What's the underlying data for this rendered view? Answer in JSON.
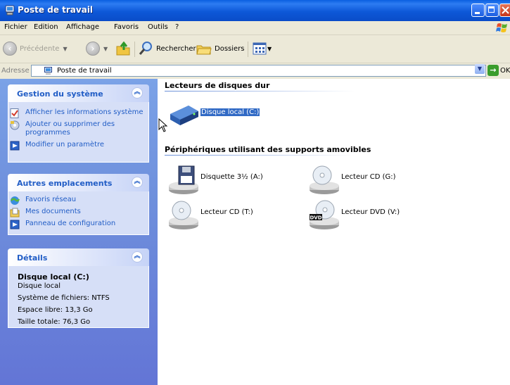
{
  "window": {
    "title": "Poste de travail"
  },
  "menu": [
    "Fichier",
    "Edition",
    "Affichage",
    "Favoris",
    "Outils",
    "?"
  ],
  "toolbar": {
    "back_label": "Précédente",
    "search_label": "Rechercher",
    "folders_label": "Dossiers"
  },
  "address": {
    "label": "Adresse",
    "value": "Poste de travail",
    "go_label": "OK"
  },
  "panels": {
    "system": {
      "title": "Gestion du système",
      "items": [
        {
          "label": "Afficher les informations système",
          "icon": "system-info-icon"
        },
        {
          "label": "Ajouter ou supprimer des programmes",
          "icon": "add-remove-programs-icon"
        },
        {
          "label": "Modifier un paramètre",
          "icon": "control-panel-icon"
        }
      ]
    },
    "places": {
      "title": "Autres emplacements",
      "items": [
        {
          "label": "Favoris réseau",
          "icon": "network-places-icon"
        },
        {
          "label": "Mes documents",
          "icon": "my-documents-icon"
        },
        {
          "label": "Panneau de configuration",
          "icon": "control-panel-icon"
        }
      ]
    },
    "details": {
      "title": "Détails",
      "name": "Disque local (C:)",
      "type": "Disque local",
      "fs": "Système de fichiers: NTFS",
      "free": "Espace libre: 13,3 Go",
      "total": "Taille totale: 76,3 Go"
    }
  },
  "content": {
    "hard_disks_header": "Lecteurs de disques dur",
    "removable_header": "Périphériques utilisant des supports amovibles",
    "local_disk": "Disque local (C:)",
    "floppy": "Disquette 3½ (A:)",
    "cd_g": "Lecteur CD (G:)",
    "cd_t": "Lecteur CD (T:)",
    "dvd_v": "Lecteur DVD (V:)",
    "dvd_badge": "DVD"
  },
  "colors": {
    "titlebar": "#0a58d8",
    "task_link": "#215dc6",
    "left_pane": "#6e8fdc",
    "selection": "#316ac5"
  }
}
